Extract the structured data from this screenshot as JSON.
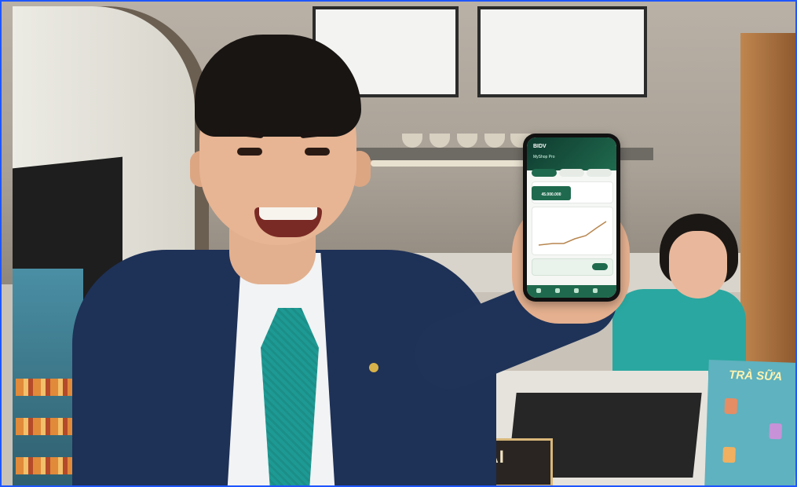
{
  "scene": {
    "menu_sign": "MÓN TẠI QUẦY",
    "poster_title": "TRÀ SỮA"
  },
  "phone": {
    "brand": "BIDV",
    "shop_name": "MyShop Pro",
    "tabs": [
      "",
      "",
      ""
    ],
    "balance": "45.000.000"
  },
  "colors": {
    "suit": "#1e3157",
    "tie": "#1e9a94",
    "app_green": "#1f6a4e",
    "woman_shirt": "#2aa7a0",
    "border": "#1e56ff"
  }
}
